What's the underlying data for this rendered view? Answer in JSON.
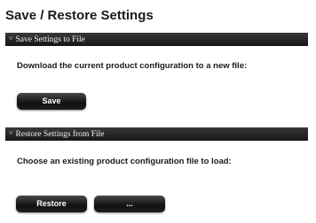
{
  "page": {
    "title": "Save / Restore Settings"
  },
  "save_section": {
    "header": "Save Settings to File",
    "chevron": "˅",
    "description": "Download the current product configuration to a new file:",
    "save_button": "Save"
  },
  "restore_section": {
    "header": "Restore Settings from File",
    "chevron": "˅",
    "description": "Choose an existing product configuration file to load:",
    "restore_button": "Restore",
    "browse_button": "..."
  }
}
